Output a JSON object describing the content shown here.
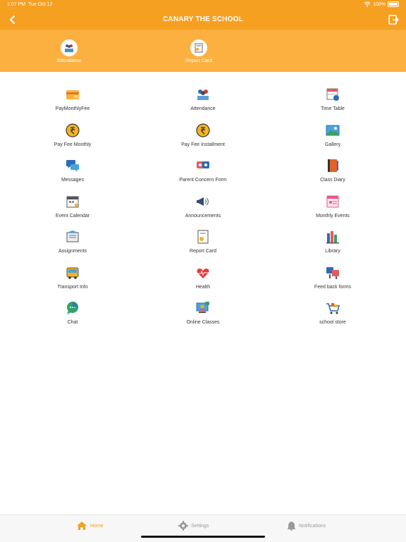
{
  "status": {
    "time": "1:07 PM",
    "date": "Tue Oct 12",
    "battery": "100%"
  },
  "header": {
    "title": "CANARY THE SCHOOL",
    "back_icon": "chevron-left-icon",
    "logout_icon": "logout-icon"
  },
  "quick_actions": [
    {
      "label": "Attendance",
      "icon": "attendance-icon"
    },
    {
      "label": "Report Card",
      "icon": "report-card-icon"
    }
  ],
  "menu": [
    {
      "label": "PayMonthlyFee",
      "icon": "wallet-icon"
    },
    {
      "label": "Attendance",
      "icon": "attendance-icon"
    },
    {
      "label": "Time Table",
      "icon": "timetable-icon"
    },
    {
      "label": "Pay Fee Monthly",
      "icon": "rupee-coin-icon"
    },
    {
      "label": "Pay Fee Installment",
      "icon": "rupee-coin-icon"
    },
    {
      "label": "Gallery",
      "icon": "gallery-icon"
    },
    {
      "label": "Messages",
      "icon": "messages-icon"
    },
    {
      "label": "Parent Concern Form",
      "icon": "concern-form-icon"
    },
    {
      "label": "Class Diary",
      "icon": "diary-icon"
    },
    {
      "label": "Event Calendar",
      "icon": "calendar-icon"
    },
    {
      "label": "Announcements",
      "icon": "megaphone-icon"
    },
    {
      "label": "Monthly Events",
      "icon": "monthly-events-icon"
    },
    {
      "label": "Assignments",
      "icon": "assignments-icon"
    },
    {
      "label": "Report Card",
      "icon": "report-card-icon"
    },
    {
      "label": "Library",
      "icon": "library-icon"
    },
    {
      "label": "Transport Info",
      "icon": "bus-icon"
    },
    {
      "label": "Health",
      "icon": "heart-icon"
    },
    {
      "label": "Feed back forms",
      "icon": "feedback-icon"
    },
    {
      "label": "Chat",
      "icon": "chat-icon"
    },
    {
      "label": "Online Classes",
      "icon": "online-classes-icon"
    },
    {
      "label": "school store",
      "icon": "cart-icon"
    }
  ],
  "tabs": [
    {
      "label": "Home",
      "icon": "home-icon",
      "active": true
    },
    {
      "label": "Settings",
      "icon": "gear-icon",
      "active": false
    },
    {
      "label": "Notifications",
      "icon": "bell-icon",
      "active": false
    }
  ],
  "colors": {
    "primary": "#f5a020",
    "quickbar": "#fbb040",
    "tab_inactive": "#9a9a9a"
  }
}
